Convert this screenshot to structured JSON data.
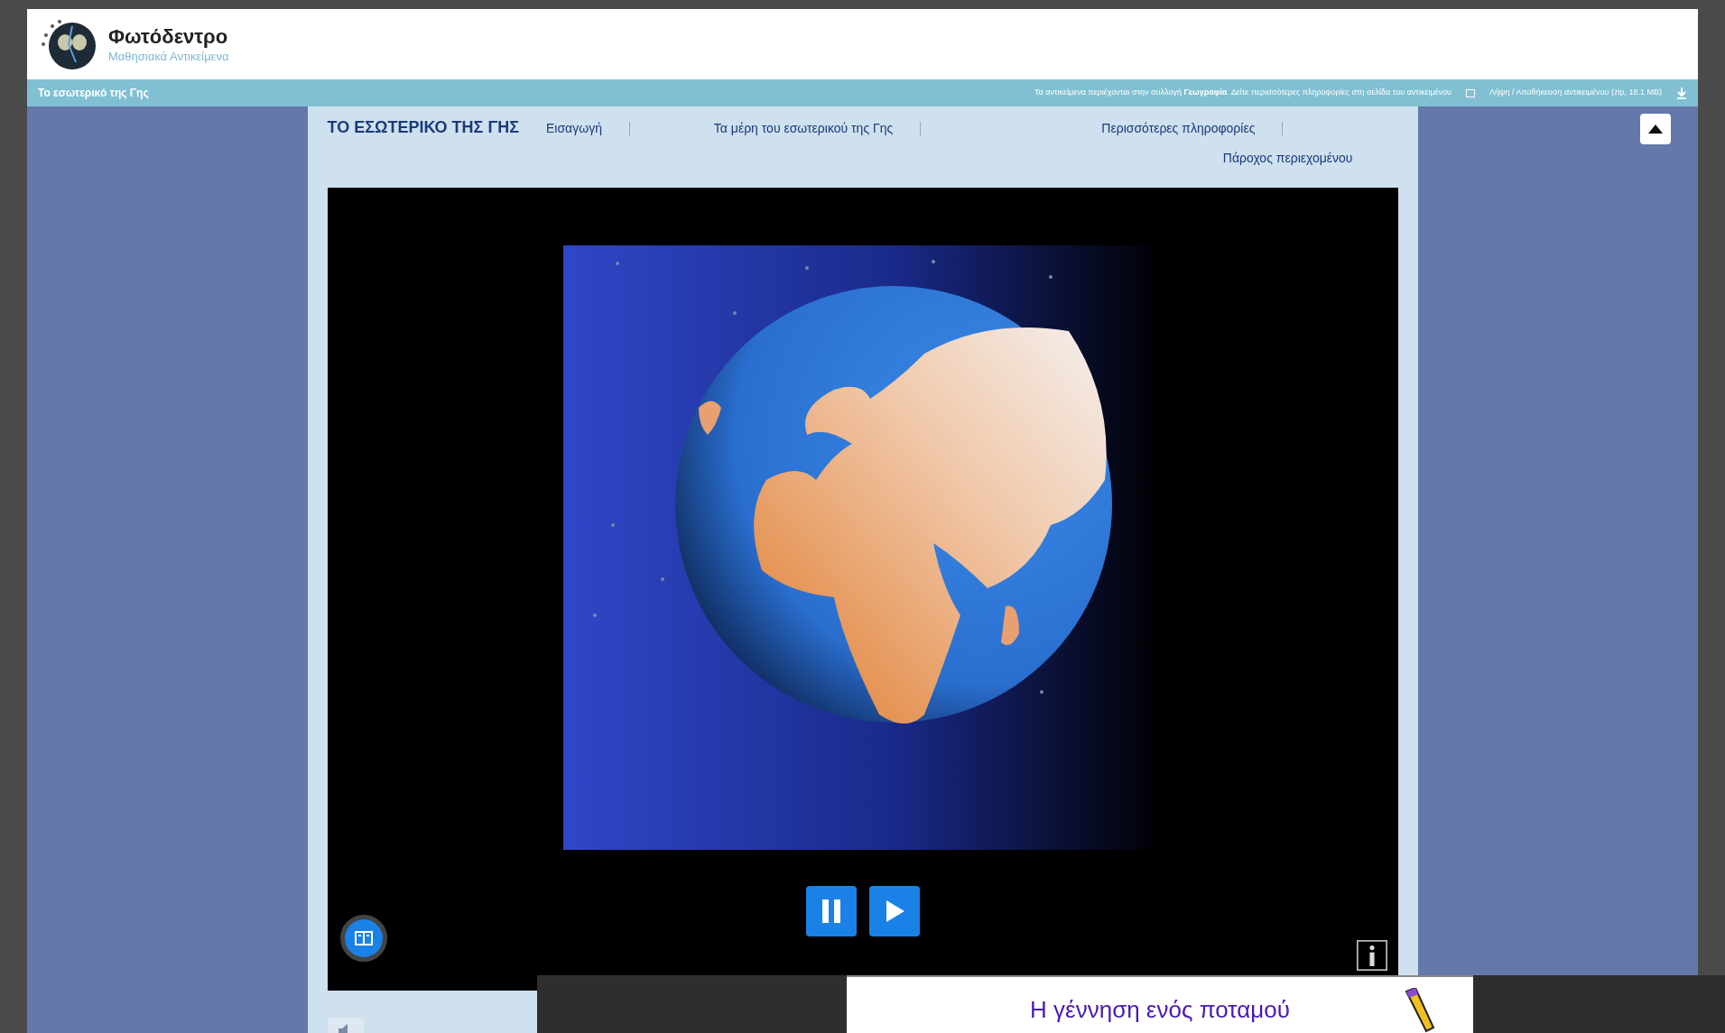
{
  "header": {
    "logo_title": "Φωτόδεντρο",
    "logo_subtitle": "Μαθησιακά Αντικείμενα"
  },
  "topbar": {
    "page_title": "Το εσωτερικό της Γης",
    "info_text": "Τα αντικείμενα περιέχονται στην συλλογή **Γεωγραφία**. Δείτε περισσότερες πληροφορίες στη σελίδα του αντικειμένου",
    "download_text": "Λήψη / Αποθήκευση αντικειμένου (zip, 18.1 MB)"
  },
  "app": {
    "title": "ΤΟ ΕΣΩΤΕΡΙΚΟ ΤΗΣ ΓΗΣ",
    "nav": [
      {
        "label": "Εισαγωγή"
      },
      {
        "label": "Τα μέρη του εσωτερικού της Γης"
      },
      {
        "label": "Περισσότερες πληροφορίες"
      },
      {
        "label": "Πάροχος περιεχομένου"
      }
    ]
  },
  "related": {
    "title": "Η γέννηση ενός ποταμού"
  }
}
